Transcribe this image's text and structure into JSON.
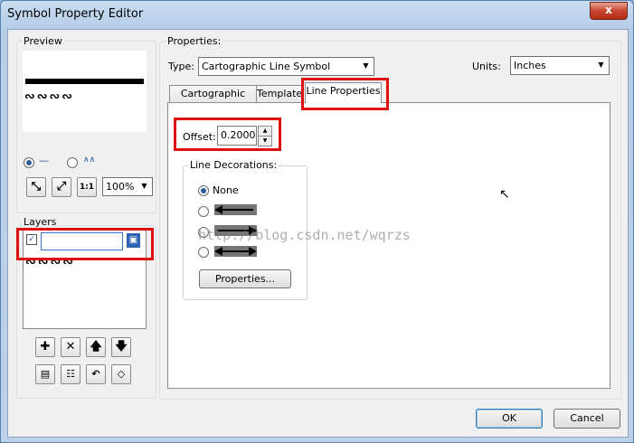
{
  "window": {
    "title": "Symbol Property Editor",
    "close_glyph": "x"
  },
  "preview": {
    "label": "Preview",
    "pattern": "∾∾∾∾",
    "radio_simple_glyph": "—",
    "radio_wave_glyph": "∧∧",
    "zoom_value": "100%"
  },
  "layers": {
    "label": "Layers",
    "layer_name": "",
    "pattern": "∾∾∾∾"
  },
  "properties": {
    "label": "Properties:",
    "type_label": "Type:",
    "type_value": "Cartographic Line Symbol",
    "units_label": "Units:",
    "units_value": "Inches",
    "tabs": [
      "Cartographic Line",
      "Template",
      "Line Properties"
    ],
    "offset_label": "Offset:",
    "offset_value": "0.2000",
    "decorations_label": "Line Decorations:",
    "none_label": "None",
    "properties_button": "Properties..."
  },
  "watermark": "http://blog.csdn.net/wqrzs",
  "footer": {
    "ok": "OK",
    "cancel": "Cancel"
  },
  "colors": {
    "highlight": "#e01010",
    "accent": "#2a5d9a"
  }
}
